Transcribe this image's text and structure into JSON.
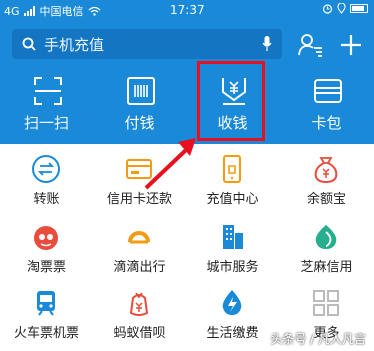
{
  "status_bar": {
    "carrier": "中国电信",
    "signal_text": "4G",
    "time": "17:37"
  },
  "header": {
    "search_placeholder": "手机充值"
  },
  "quick_actions": [
    {
      "label": "扫一扫",
      "icon": "scan-icon"
    },
    {
      "label": "付钱",
      "icon": "barcode-icon"
    },
    {
      "label": "收钱",
      "icon": "receive-money-icon"
    },
    {
      "label": "卡包",
      "icon": "wallet-icon"
    }
  ],
  "grid": [
    {
      "label": "转账",
      "icon": "transfer-icon"
    },
    {
      "label": "信用卡还款",
      "icon": "credit-card-icon"
    },
    {
      "label": "充值中心",
      "icon": "phone-recharge-icon"
    },
    {
      "label": "余额宝",
      "icon": "money-bag-icon"
    },
    {
      "label": "淘票票",
      "icon": "movie-ticket-icon"
    },
    {
      "label": "滴滴出行",
      "icon": "didi-icon"
    },
    {
      "label": "城市服务",
      "icon": "city-building-icon"
    },
    {
      "label": "芝麻信用",
      "icon": "sesame-credit-icon"
    },
    {
      "label": "火车票机票",
      "icon": "train-icon"
    },
    {
      "label": "蚂蚁借呗",
      "icon": "ant-loan-icon"
    },
    {
      "label": "生活缴费",
      "icon": "utility-icon"
    },
    {
      "label": "更多",
      "icon": "more-grid-icon"
    }
  ],
  "watermark": "头条号 / 凡人凡言",
  "colors": {
    "brand_blue": "#1a8ad8",
    "highlight_red": "#e8101f"
  }
}
